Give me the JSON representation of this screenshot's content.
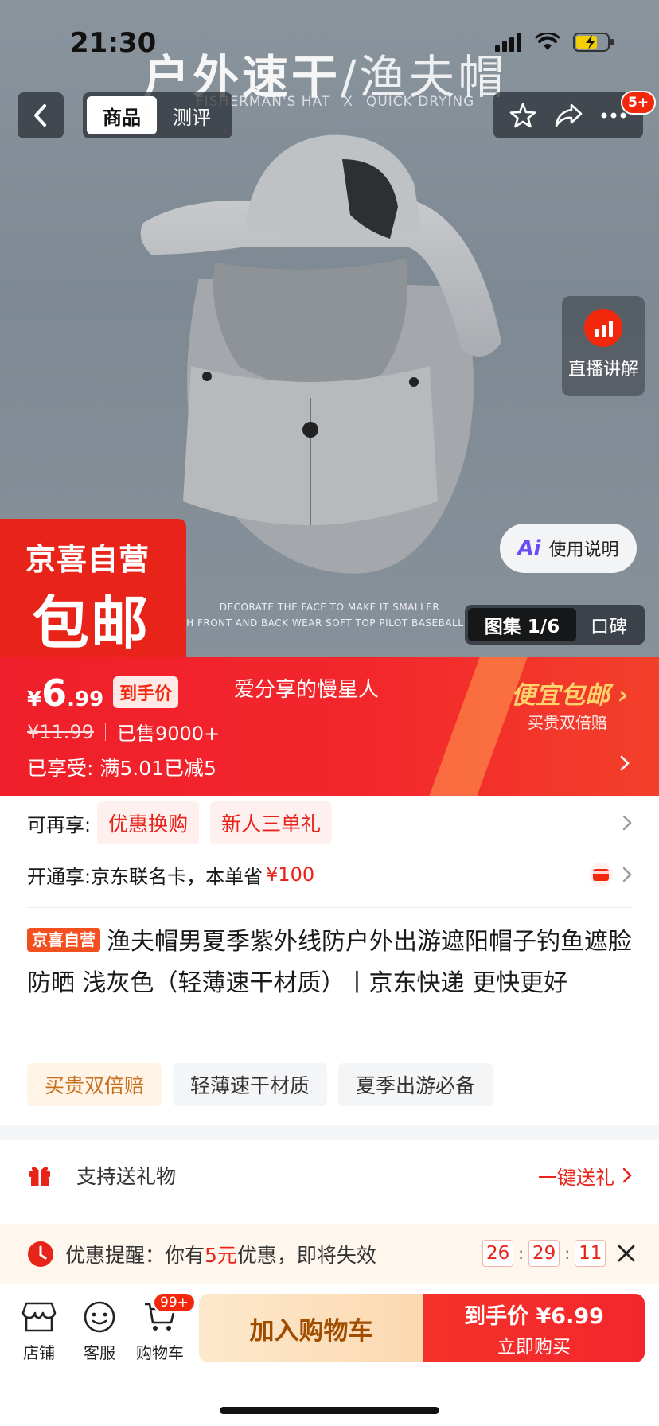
{
  "status_bar": {
    "time": "21:30"
  },
  "hero": {
    "title_bold": "户外速干",
    "title_thin": "/渔夫帽",
    "sub_left": "FISHERMAN'S HAT",
    "sub_x": "X",
    "sub_right": "QUICK DRYING",
    "caption1": "DECORATE THE FACE TO MAKE IT SMALLER",
    "caption2": "BOTH FRONT AND BACK WEAR SOFT TOP PILOT BASEBALL CAPS",
    "corner_line1": "京喜自营",
    "corner_line2": "包邮"
  },
  "nav": {
    "tabs": [
      {
        "label": "商品"
      },
      {
        "label": "测评"
      }
    ],
    "message_badge": "5+"
  },
  "live": {
    "label": "直播讲解"
  },
  "usage": {
    "icon_text": "Ai",
    "label": "使用说明"
  },
  "gallery": {
    "label": "图集 1/6",
    "reviews": "口碑"
  },
  "price": {
    "currency": "¥",
    "integer": "6",
    "decimal": ".99",
    "tag": "到手价",
    "seller": "爱分享的慢星人",
    "promo_title": "便宜包邮",
    "promo_sub": "买贵双倍赔",
    "original": "¥11.99",
    "sold": "已售9000+",
    "enjoyed": "已享受: 满5.01已减5"
  },
  "promos": {
    "more_label": "可再享:",
    "chip1": "优惠换购",
    "chip2": "新人三单礼",
    "card_label": "开通享:京东联名卡，本单省",
    "card_save": "¥100"
  },
  "product": {
    "tag": "京喜自营",
    "title": "渔夫帽男夏季紫外线防户外出游遮阳帽子钓鱼遮脸防晒 浅灰色（轻薄速干材质）丨京东快递 更快更好",
    "tags": [
      "买贵双倍赔",
      "轻薄速干材质",
      "夏季出游必备"
    ]
  },
  "gift": {
    "label": "支持送礼物",
    "action": "一键送礼"
  },
  "reminder": {
    "prefix": "优惠提醒：你有",
    "amount": "5元",
    "suffix": "优惠，即将失效",
    "hours": "26",
    "minutes": "29",
    "seconds": "11"
  },
  "bottom_bar": {
    "shop": "店铺",
    "service": "客服",
    "cart": "购物车",
    "cart_badge": "99+",
    "add_to_cart": "加入购物车",
    "buy_line1": "到手价 ¥6.99",
    "buy_line2": "立即购买"
  },
  "colors": {
    "brand_red": "#f2270c",
    "price_band": "#f3262c",
    "cart_button": "#fbd9b0"
  }
}
